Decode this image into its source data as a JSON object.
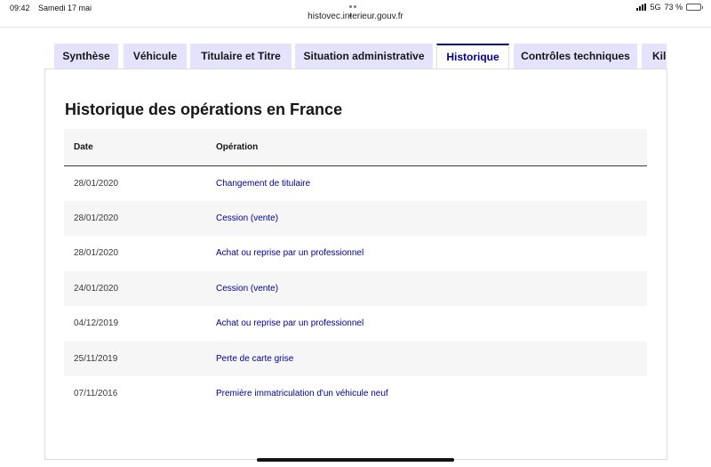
{
  "status_bar": {
    "time": "09:42",
    "date": "Samedi 17 mai",
    "network": "5G",
    "battery": "73 %",
    "battery_level": 0.73
  },
  "browser": {
    "url": "histovec.interieur.gouv.fr"
  },
  "tabs": [
    {
      "label": "Synthèse",
      "active": false
    },
    {
      "label": "Véhicule",
      "active": false
    },
    {
      "label": "Titulaire et Titre",
      "active": false
    },
    {
      "label": "Situation administrative",
      "active": false
    },
    {
      "label": "Historique",
      "active": true
    },
    {
      "label": "Contrôles techniques",
      "active": false
    },
    {
      "label": "Kilo",
      "active": false
    }
  ],
  "history": {
    "title": "Historique des opérations en France",
    "columns": {
      "date": "Date",
      "operation": "Opération"
    },
    "rows": [
      {
        "date": "28/01/2020",
        "operation": "Changement de titulaire"
      },
      {
        "date": "28/01/2020",
        "operation": "Cession (vente)"
      },
      {
        "date": "28/01/2020",
        "operation": "Achat ou reprise par un professionnel"
      },
      {
        "date": "24/01/2020",
        "operation": "Cession (vente)"
      },
      {
        "date": "04/12/2019",
        "operation": "Achat ou reprise par un professionnel"
      },
      {
        "date": "25/11/2019",
        "operation": "Perte de carte grise"
      },
      {
        "date": "07/11/2016",
        "operation": "Première immatriculation d'un véhicule neuf"
      }
    ]
  },
  "colors": {
    "accent": "#000091",
    "tab_background": "#e3e3fd",
    "row_stripe": "#f6f6f6"
  }
}
